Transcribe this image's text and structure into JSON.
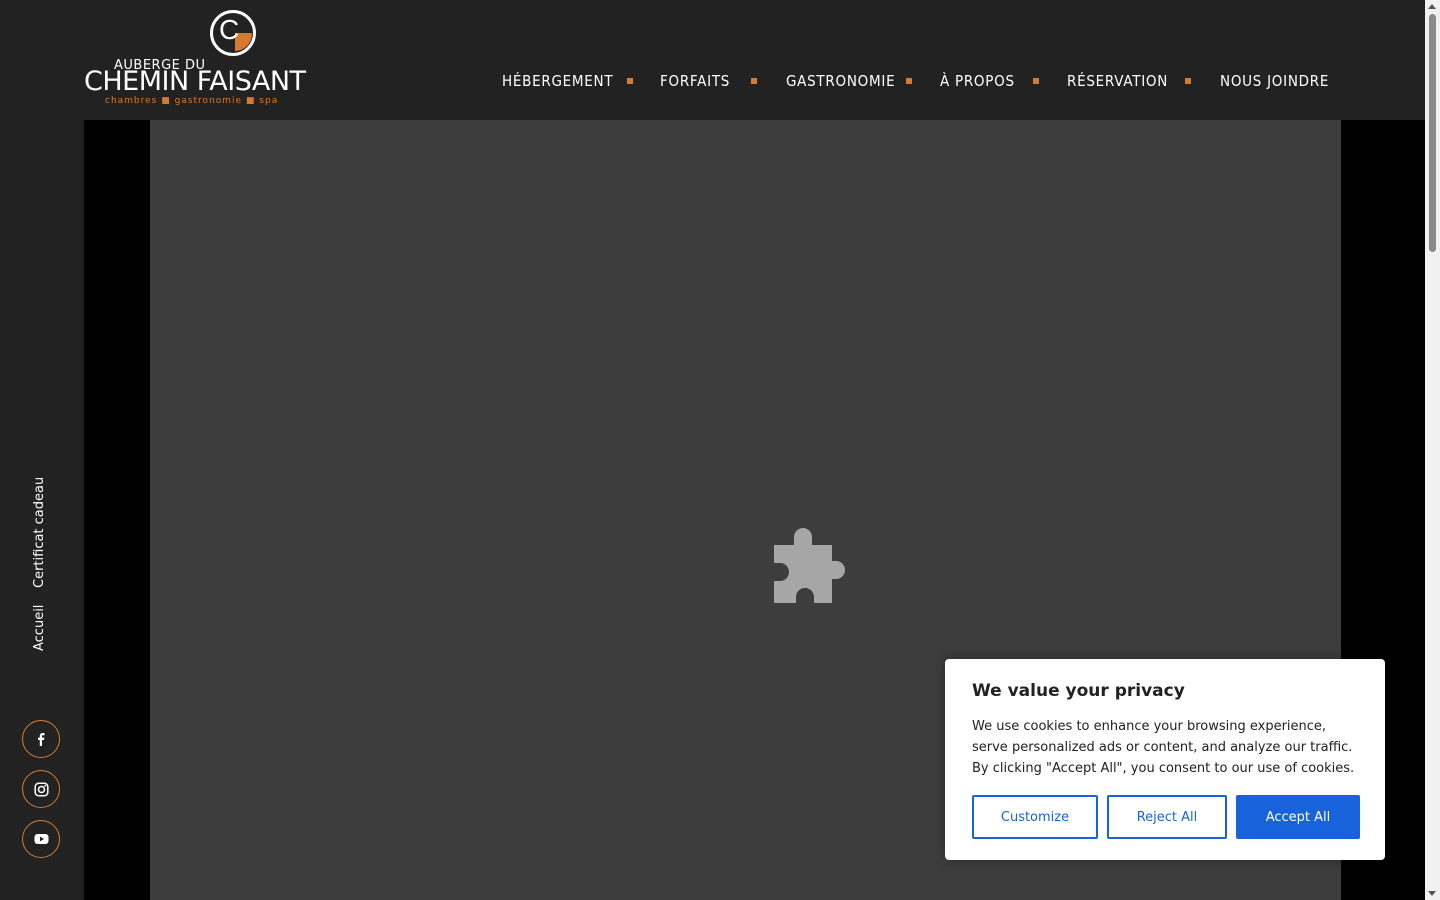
{
  "brand": {
    "monogram": "C",
    "line1": "AUBERGE DU",
    "line2": "CHEMIN FAISANT",
    "tagline": "chambres ■ gastronomie ■ spa",
    "accent_color": "#d57a2e"
  },
  "nav": {
    "items": [
      {
        "label": "HÉBERGEMENT"
      },
      {
        "label": "FORFAITS"
      },
      {
        "label": "GASTRONOMIE"
      },
      {
        "label": "À PROPOS"
      },
      {
        "label": "RÉSERVATION"
      },
      {
        "label": "NOUS JOINDRE"
      }
    ]
  },
  "sidebar": {
    "links": [
      {
        "label": "Certificat cadeau"
      },
      {
        "label": "Accueil"
      }
    ],
    "social": [
      {
        "icon": "facebook-icon"
      },
      {
        "icon": "instagram-icon"
      },
      {
        "icon": "youtube-icon"
      }
    ]
  },
  "media": {
    "icon": "puzzle-plugin-icon"
  },
  "cookie": {
    "title": "We value your privacy",
    "body": "We use cookies to enhance your browsing experience, serve personalized ads or content, and analyze our traffic. By clicking \"Accept All\", you consent to our use of cookies.",
    "customize_label": "Customize",
    "reject_label": "Reject All",
    "accept_label": "Accept All",
    "button_color": "#1863dc"
  }
}
